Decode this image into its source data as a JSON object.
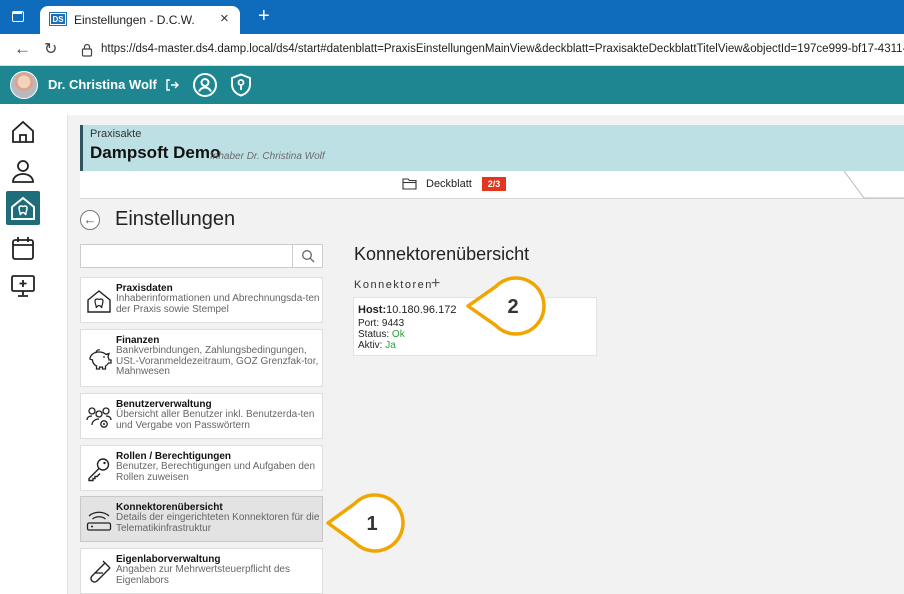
{
  "browser": {
    "tab_favicon": "DS",
    "tab_title": "Einstellungen - D.C.W.",
    "url": "https://ds4-master.ds4.damp.local/ds4/start#datenblatt=PraxisEinstellungenMainView&deckblatt=PraxisakteDeckblattTitelView&objectId=197ce999-bf17-4311-"
  },
  "appbar": {
    "user_name": "Dr. Christina Wolf"
  },
  "akte": {
    "label": "Praxisakte",
    "title": "Dampsoft Demo",
    "subtitle": "Inhaber Dr. Christina Wolf",
    "deck_label": "Deckblatt",
    "deck_badge": "2/3"
  },
  "page_title": "Einstellungen",
  "menu": [
    {
      "title": "Praxisdaten",
      "desc": "Inhaberinformationen und Abrechnungsda-ten der Praxis sowie Stempel",
      "icon": "house-tooth-icon"
    },
    {
      "title": "Finanzen",
      "desc": "Bankverbindungen, Zahlungsbedingungen, USt.-Voranmeldezeitraum, GOZ Grenzfak-tor, Mahnwesen",
      "icon": "piggy-bank-icon"
    },
    {
      "title": "Benutzerverwaltung",
      "desc": "Übersicht aller Benutzer inkl. Benutzerda-ten und Vergabe von Passwörtern",
      "icon": "users-gear-icon"
    },
    {
      "title": "Rollen / Berechtigungen",
      "desc": "Benutzer, Berechtigungen und Aufgaben den Rollen zuweisen",
      "icon": "key-icon"
    },
    {
      "title": "Konnektorenübersicht",
      "desc": "Details der eingerichteten Konnektoren für die Telematikinfrastruktur",
      "icon": "router-icon"
    },
    {
      "title": "Eigenlaborverwaltung",
      "desc": "Angaben zur Mehrwertsteuerpflicht des Eigenlabors",
      "icon": "test-tube-icon"
    }
  ],
  "section": {
    "title": "Konnektorenübersicht",
    "konnektoren_label": "Konnektoren",
    "add_symbol": "+"
  },
  "konnektor": {
    "host_label": "Host:",
    "host_value": "10.180.96.172",
    "port": "Port: 9443",
    "status_label": "Status:",
    "status_value": "Ok",
    "aktiv_label": "Aktiv:",
    "aktiv_value": "Ja"
  },
  "callouts": [
    "1",
    "2"
  ],
  "colors": {
    "browser_blue": "#0f6cbd",
    "appbar_teal": "#1d8691",
    "nav_active": "#1d6e78",
    "akte_header": "#bde0e5",
    "badge_red": "#e2361f",
    "callout_orange": "#f0a500",
    "ok_green": "#2e9e3e"
  }
}
